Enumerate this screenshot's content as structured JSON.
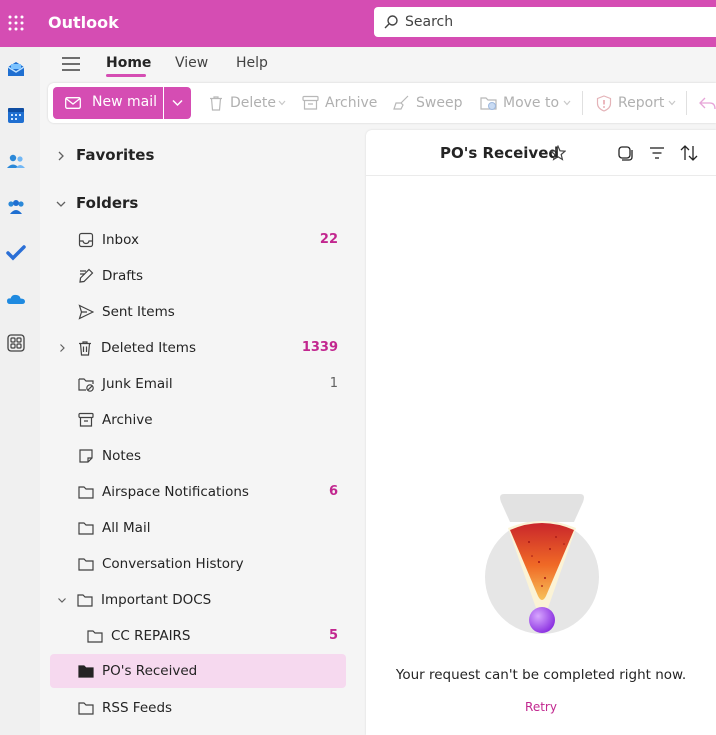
{
  "app": {
    "title": "Outlook",
    "brand_color": "#d54db3",
    "accent_text": "#c2278f"
  },
  "search": {
    "placeholder": "Search",
    "icon": "search-icon"
  },
  "rail": {
    "icons": [
      "mail-icon",
      "calendar-icon",
      "people-icon",
      "groups-icon",
      "todo-icon",
      "onedrive-icon",
      "apps-icon"
    ]
  },
  "ribbon": {
    "tabs": [
      {
        "label": "Home",
        "active": true
      },
      {
        "label": "View",
        "active": false
      },
      {
        "label": "Help",
        "active": false
      }
    ]
  },
  "toolbar": {
    "new_mail": "New mail",
    "delete": "Delete",
    "archive": "Archive",
    "sweep": "Sweep",
    "move_to": "Move to",
    "report": "Report"
  },
  "folders": {
    "favorites_label": "Favorites",
    "folders_label": "Folders",
    "items": [
      {
        "name": "Inbox",
        "count": "22",
        "icon": "inbox-icon"
      },
      {
        "name": "Drafts",
        "count": "",
        "icon": "drafts-icon"
      },
      {
        "name": "Sent Items",
        "count": "",
        "icon": "sent-icon"
      },
      {
        "name": "Deleted Items",
        "count": "1339",
        "icon": "trash-icon"
      },
      {
        "name": "Junk Email",
        "count": "1",
        "icon": "junk-icon"
      },
      {
        "name": "Archive",
        "count": "",
        "icon": "archive-icon"
      },
      {
        "name": "Notes",
        "count": "",
        "icon": "notes-icon"
      },
      {
        "name": "Airspace Notifications",
        "count": "6",
        "icon": "folder-icon"
      },
      {
        "name": "All Mail",
        "count": "",
        "icon": "folder-icon"
      },
      {
        "name": "Conversation History",
        "count": "",
        "icon": "folder-icon"
      },
      {
        "name": "Important DOCS",
        "count": "",
        "icon": "folder-icon"
      },
      {
        "name": "CC REPAIRS",
        "count": "5",
        "icon": "folder-icon"
      },
      {
        "name": "PO's Received",
        "count": "",
        "icon": "folder-filled-icon",
        "selected": true
      },
      {
        "name": "RSS Feeds",
        "count": "",
        "icon": "folder-icon"
      }
    ]
  },
  "list": {
    "title": "PO's Received",
    "error_message": "Your request can't be completed right now.",
    "retry": "Retry"
  }
}
